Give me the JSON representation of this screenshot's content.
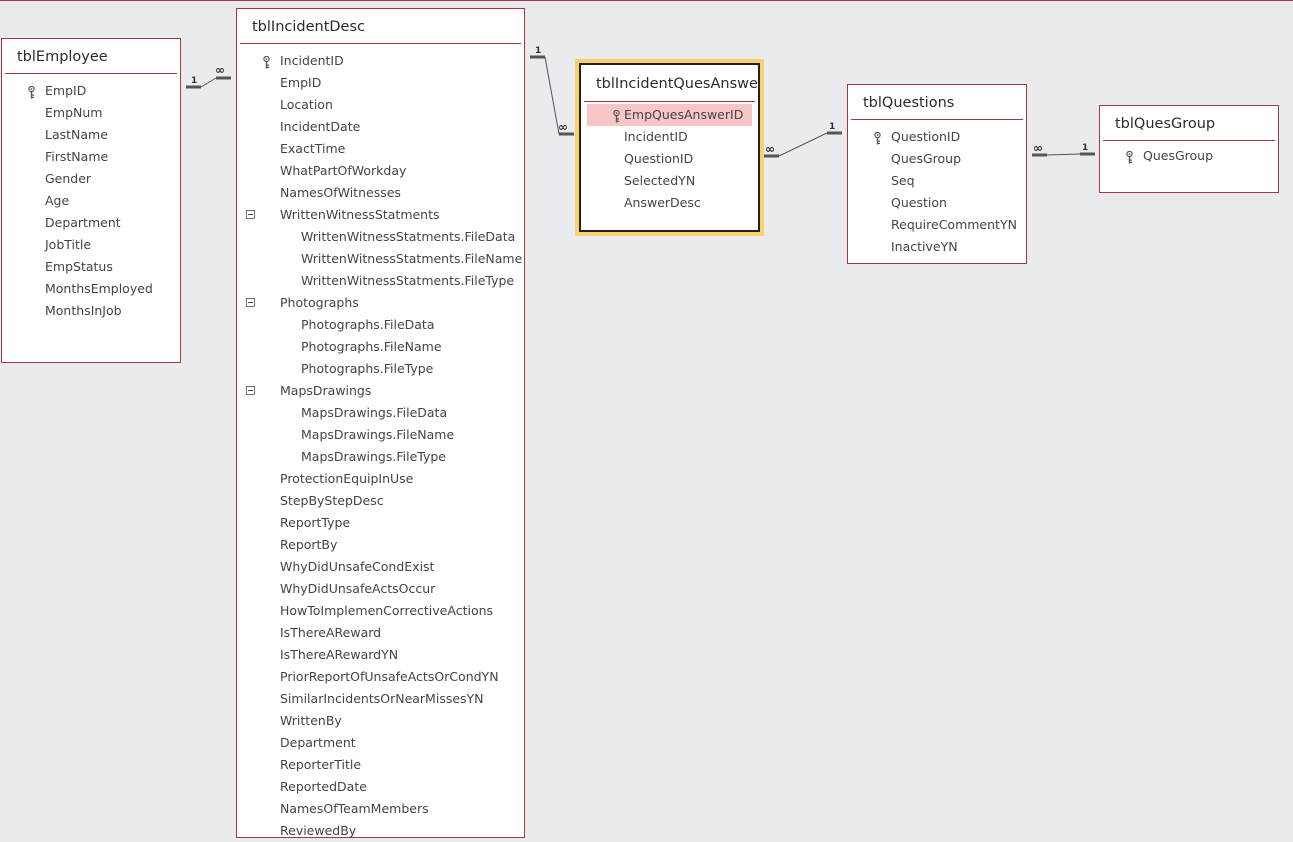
{
  "tables": {
    "employee": {
      "title": "tblEmployee",
      "fields": [
        "EmpID",
        "EmpNum",
        "LastName",
        "FirstName",
        "Gender",
        "Age",
        "Department",
        "JobTitle",
        "EmpStatus",
        "MonthsEmployed",
        "MonthsInJob"
      ]
    },
    "incident_desc": {
      "title": "tblIncidentDesc",
      "fields": [
        "IncidentID",
        "EmpID",
        "Location",
        "IncidentDate",
        "ExactTime",
        "WhatPartOfWorkday",
        "NamesOfWitnesses",
        "WrittenWitnessStatments",
        "WrittenWitnessStatments.FileData",
        "WrittenWitnessStatments.FileName",
        "WrittenWitnessStatments.FileType",
        "Photographs",
        "Photographs.FileData",
        "Photographs.FileName",
        "Photographs.FileType",
        "MapsDrawings",
        "MapsDrawings.FileData",
        "MapsDrawings.FileName",
        "MapsDrawings.FileType",
        "ProtectionEquipInUse",
        "StepByStepDesc",
        "ReportType",
        "ReportBy",
        "WhyDidUnsafeCondExist",
        "WhyDidUnsafeActsOccur",
        "HowToImplemenCorrectiveActions",
        "IsThereAReward",
        "IsThereARewardYN",
        "PriorReportOfUnsafeActsOrCondYN",
        "SimilarIncidentsOrNearMissesYN",
        "WrittenBy",
        "Department",
        "ReporterTitle",
        "ReportedDate",
        "NamesOfTeamMembers",
        "ReviewedBy"
      ]
    },
    "ques_answer": {
      "title": "tblIncidentQuesAnswer",
      "fields": [
        "EmpQuesAnswerID",
        "IncidentID",
        "QuestionID",
        "SelectedYN",
        "AnswerDesc"
      ]
    },
    "questions": {
      "title": "tblQuestions",
      "fields": [
        "QuestionID",
        "QuesGroup",
        "Seq",
        "Question",
        "RequireCommentYN",
        "InactiveYN"
      ]
    },
    "ques_group": {
      "title": "tblQuesGroup",
      "fields": [
        "QuesGroup"
      ]
    }
  },
  "relationships": {
    "one_label": "1",
    "many_label": "∞"
  },
  "colors": {
    "table_border": "#a4373a",
    "selected_outline": "#f8d26a",
    "highlight_row": "#f8c6c7",
    "background": "#e9ebee"
  }
}
